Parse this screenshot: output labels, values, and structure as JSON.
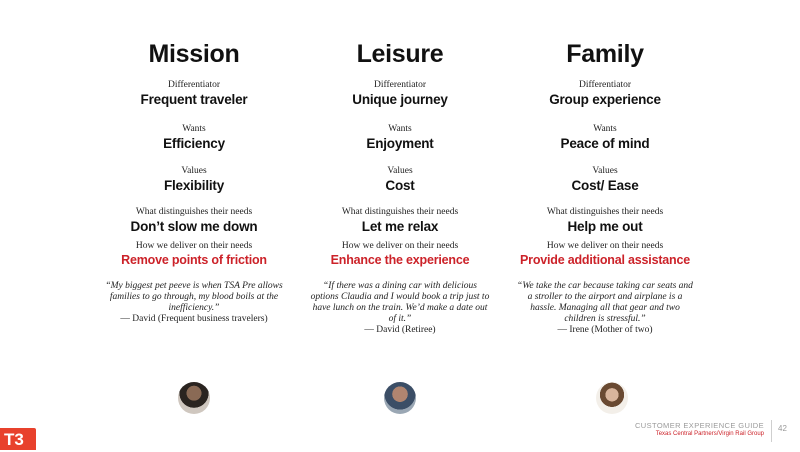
{
  "columns": [
    {
      "title": "Mission",
      "differentiator_label": "Differentiator",
      "differentiator": "Frequent traveler",
      "wants_label": "Wants",
      "wants": "Efficiency",
      "values_label": "Values",
      "values": "Flexibility",
      "needs_label": "What distinguishes their needs",
      "needs": "Don’t slow me down",
      "deliver_label": "How we deliver on their needs",
      "deliver": "Remove points of friction",
      "quote": "“My biggest pet peeve is when TSA Pre allows families to go through, my blood boils at the inefficiency.”",
      "attribution": "— David (Frequent business travelers)"
    },
    {
      "title": "Leisure",
      "differentiator_label": "Differentiator",
      "differentiator": "Unique journey",
      "wants_label": "Wants",
      "wants": "Enjoyment",
      "values_label": "Values",
      "values": "Cost",
      "needs_label": "What distinguishes their needs",
      "needs": "Let me relax",
      "deliver_label": "How we deliver on their needs",
      "deliver": "Enhance the experience",
      "quote": "“If there was a dining car with delicious options Claudia and I would book a trip just to have lunch on the train. We’d make a date out of it.”",
      "attribution": "— David (Retiree)"
    },
    {
      "title": "Family",
      "differentiator_label": "Differentiator",
      "differentiator": "Group experience",
      "wants_label": "Wants",
      "wants": "Peace of mind",
      "values_label": "Values",
      "values": "Cost/ Ease",
      "needs_label": "What distinguishes their needs",
      "needs": "Help me out",
      "deliver_label": "How we deliver on their needs",
      "deliver": "Provide additional assistance",
      "quote": "“We take the car because taking car seats and a stroller to the airport and airplane is a hassle. Managing all that gear and two children is stressful.”",
      "attribution": "— Irene (Mother of two)"
    }
  ],
  "logo": "T3",
  "footer": {
    "title": "CUSTOMER EXPERIENCE GUIDE",
    "subtitle": "Texas Central Partners/Virgin Rail Group",
    "page": "42"
  },
  "colors": {
    "accent": "#cc2229",
    "logo": "#e8412c"
  }
}
